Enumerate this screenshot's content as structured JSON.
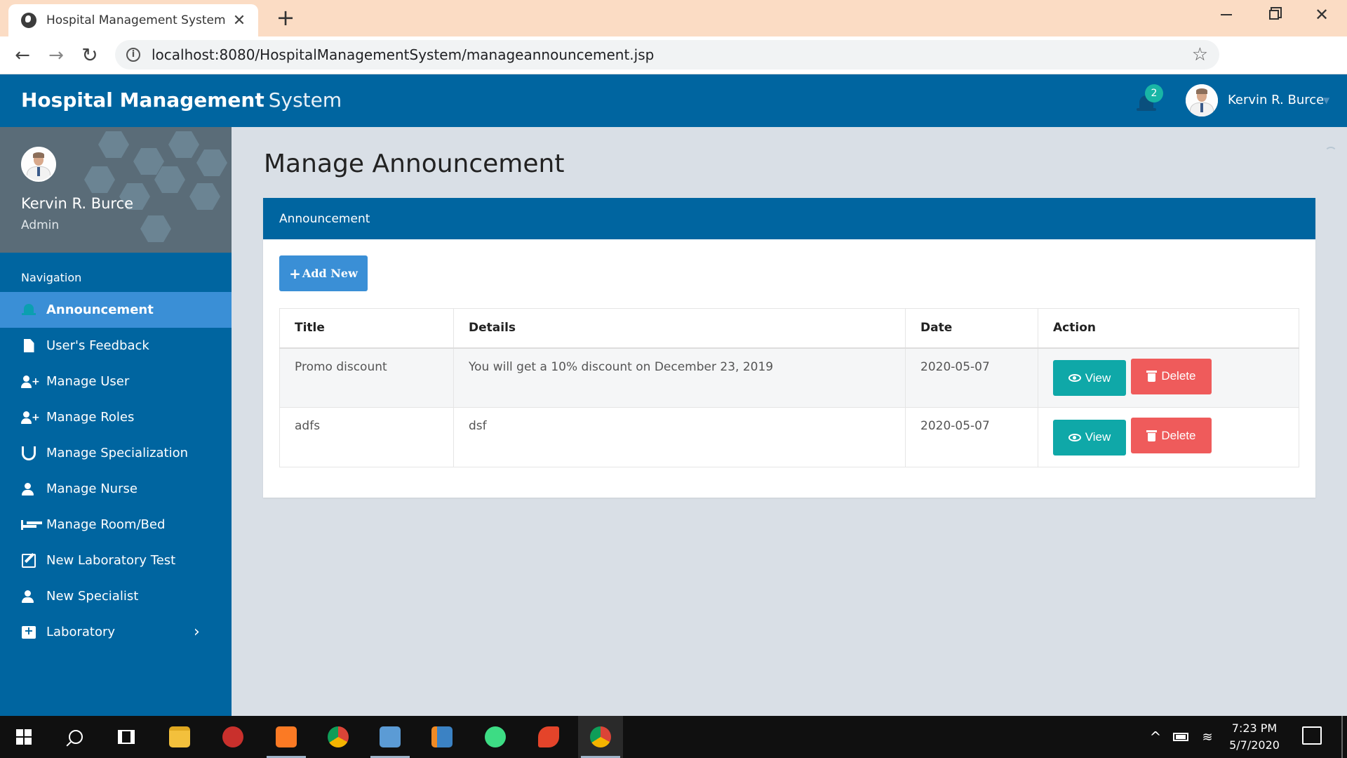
{
  "browser": {
    "tab_title": "Hospital Management System",
    "tab_close": "✕",
    "new_tab": "+",
    "url": "localhost:8080/HospitalManagementSystem/manageannouncement.jsp",
    "window_close": "✕",
    "back": "←",
    "forward": "→",
    "reload": "↻",
    "star": "☆",
    "menu": "⋮"
  },
  "header": {
    "brand_bold": "Hospital Management",
    "brand_light": "System",
    "notification_count": "2",
    "user_name": "Kervin R. Burce",
    "caret": "▼"
  },
  "sidebar": {
    "profile_name": "Kervin R. Burce",
    "profile_role": "Admin",
    "nav_heading": "Navigation",
    "items": [
      {
        "label": "Announcement",
        "icon": "bell-icon",
        "active": true
      },
      {
        "label": "User's Feedback",
        "icon": "file-icon"
      },
      {
        "label": "Manage User",
        "icon": "user-plus-icon"
      },
      {
        "label": "Manage Roles",
        "icon": "user-plus-icon"
      },
      {
        "label": "Manage Specialization",
        "icon": "stethoscope-icon"
      },
      {
        "label": "Manage Nurse",
        "icon": "user-icon"
      },
      {
        "label": "Manage Room/Bed",
        "icon": "bed-icon"
      },
      {
        "label": "New Laboratory Test",
        "icon": "edit-icon"
      },
      {
        "label": "New Specialist",
        "icon": "user-icon"
      },
      {
        "label": "Laboratory",
        "icon": "medkit-icon",
        "chevron": "›"
      }
    ]
  },
  "main": {
    "page_title": "Manage Announcement",
    "panel_title": "Announcement",
    "add_button": "Add New",
    "add_icon": "+",
    "table": {
      "headers": [
        "Title",
        "Details",
        "Date",
        "Action"
      ],
      "rows": [
        {
          "title": "Promo discount",
          "details": "You will get a 10% discount on December 23, 2019",
          "date": "2020-05-07"
        },
        {
          "title": "adfs",
          "details": "dsf",
          "date": "2020-05-07"
        }
      ],
      "view_label": "View",
      "delete_label": "Delete"
    }
  },
  "taskbar": {
    "time": "7:23 PM",
    "date": "5/7/2020",
    "tray_chevron": "^",
    "wifi": "≋"
  },
  "colors": {
    "primary": "#0065a0",
    "active": "#3a8fd6",
    "view": "#0fa8a8",
    "delete": "#ef5b5b",
    "badge": "#19b5a5"
  }
}
